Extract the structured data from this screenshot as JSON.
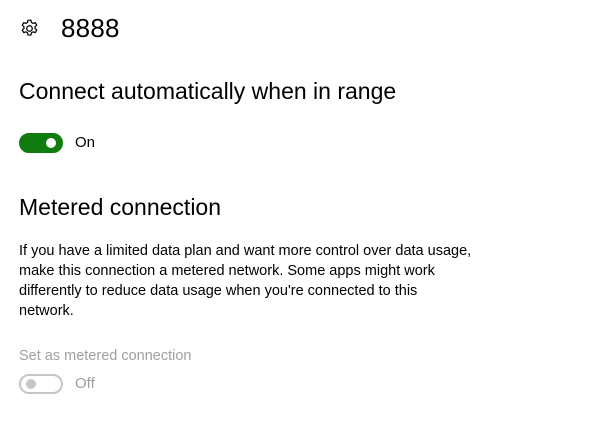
{
  "header": {
    "title": "8888",
    "icon": "gear-icon"
  },
  "auto_connect": {
    "heading": "Connect automatically when in range",
    "toggle_state": "On",
    "is_on": true,
    "accent_color": "#107c10"
  },
  "metered": {
    "heading": "Metered connection",
    "description": "If you have a limited data plan and want more control over data usage, make this connection a metered network. Some apps might work differently to reduce data usage when you're connected to this network.",
    "setting_label": "Set as metered connection",
    "toggle_state": "Off",
    "is_on": false,
    "disabled_color": "#a0a0a0"
  }
}
